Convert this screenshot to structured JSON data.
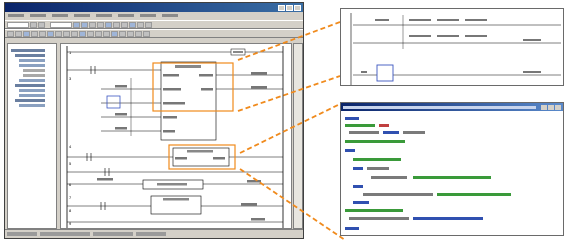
{
  "callout_color": "#f08a1c",
  "editor": {
    "rung_numbers": [
      "1",
      "3",
      "4",
      "5",
      "6",
      "7",
      "8",
      "9"
    ]
  }
}
